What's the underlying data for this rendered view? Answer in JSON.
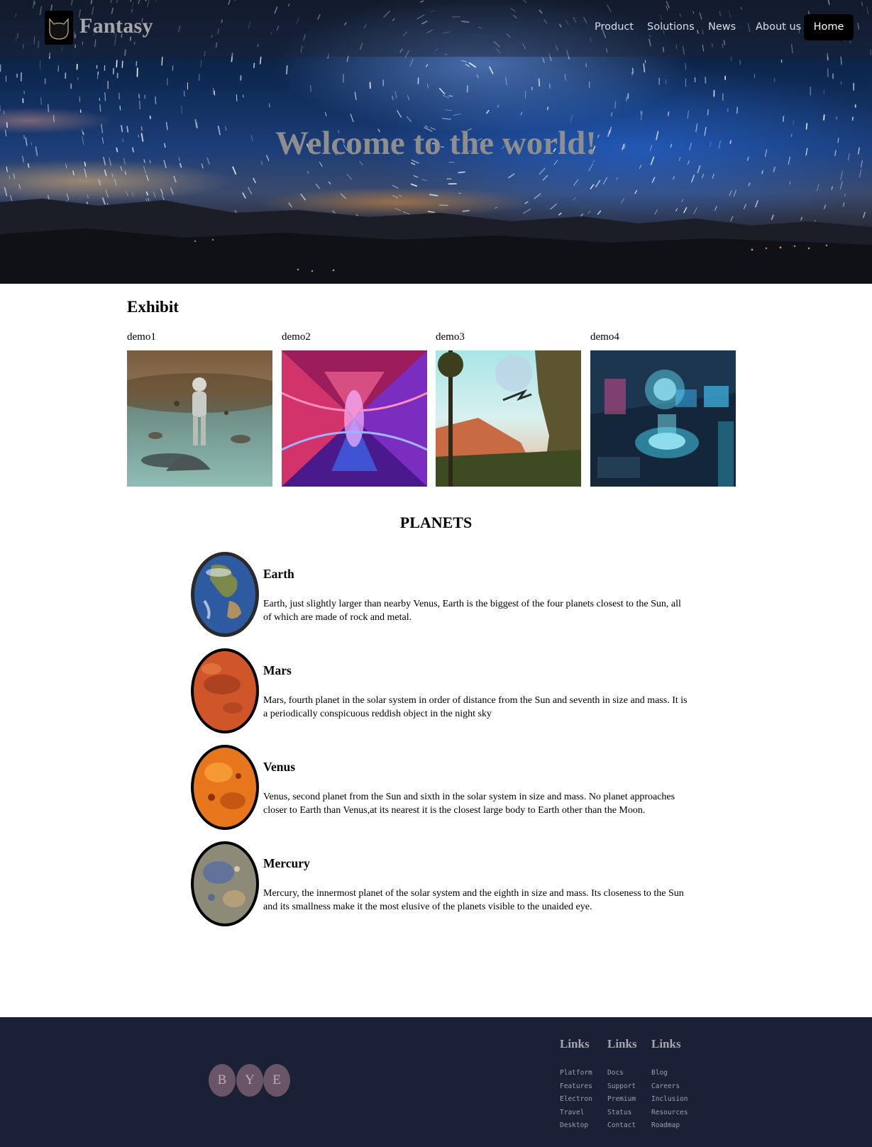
{
  "header": {
    "brand": "Fantasy",
    "logo_icon": "cat-head-icon",
    "nav": [
      "Product",
      "Solutions",
      "News",
      "About us"
    ],
    "home_label": "Home",
    "hero_title": "Welcome to the world!"
  },
  "exhibit": {
    "title": "Exhibit",
    "items": [
      {
        "label": "demo1",
        "image": "astronaut-floating-rocks-image"
      },
      {
        "label": "demo2",
        "image": "neon-abstract-corridor-image"
      },
      {
        "label": "demo3",
        "image": "alien-planet-landscape-image"
      },
      {
        "label": "demo4",
        "image": "sci-fi-lab-room-image"
      }
    ]
  },
  "planets": {
    "title": "PLANETS",
    "items": [
      {
        "name": "Earth",
        "description": "Earth, just slightly larger than nearby Venus, Earth is the biggest of the four planets closest to the Sun, all of which are made of rock and metal.",
        "image": "earth-image"
      },
      {
        "name": "Mars",
        "description": "Mars, fourth planet in the solar system in order of distance from the Sun and seventh in size and mass. It is a periodically conspicuous reddish object in the night sky",
        "image": "mars-image"
      },
      {
        "name": "Venus",
        "description": "Venus, second planet from the Sun and sixth in the solar system in size and mass. No planet approaches closer to Earth than Venus,at its nearest it is the closest large body to Earth other than the Moon.",
        "image": "venus-image"
      },
      {
        "name": "Mercury",
        "description": "Mercury, the innermost planet of the solar system and the eighth in size and mass. Its closeness to the Sun and its smallness make it the most elusive of the planets visible to the unaided eye.",
        "image": "mercury-image"
      }
    ]
  },
  "footer": {
    "bye": [
      "B",
      "Y",
      "E"
    ],
    "columns": [
      {
        "title": "Links",
        "items": [
          "Platform",
          "Features",
          "Electron",
          "Travel",
          "Desktop"
        ]
      },
      {
        "title": "Links",
        "items": [
          "Docs",
          "Support",
          "Premium",
          "Status",
          "Contact"
        ]
      },
      {
        "title": "Links",
        "items": [
          "Blog",
          "Careers",
          "Inclusion",
          "Resources",
          "Roadmap"
        ]
      }
    ]
  }
}
